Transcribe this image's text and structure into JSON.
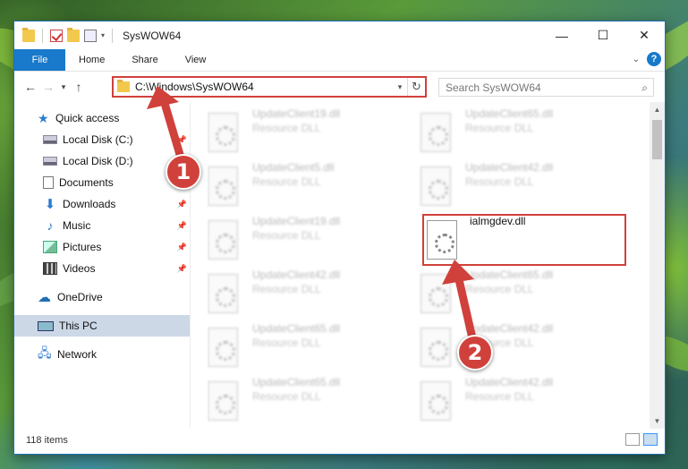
{
  "window": {
    "title": "SysWOW64",
    "minimize": "—",
    "maximize": "☐",
    "close": "✕"
  },
  "ribbon": {
    "file": "File",
    "tabs": [
      "Home",
      "Share",
      "View"
    ]
  },
  "address": {
    "path": "C:\\Windows\\SysWOW64",
    "search_placeholder": "Search SysWOW64"
  },
  "nav": {
    "quick_access": "Quick access",
    "items": [
      {
        "label": "Local Disk (C:)",
        "pinned": true
      },
      {
        "label": "Local Disk (D:)",
        "pinned": true
      },
      {
        "label": "Documents",
        "pinned": true
      },
      {
        "label": "Downloads",
        "pinned": true
      },
      {
        "label": "Music",
        "pinned": true
      },
      {
        "label": "Pictures",
        "pinned": true
      },
      {
        "label": "Videos",
        "pinned": true
      }
    ],
    "onedrive": "OneDrive",
    "this_pc": "This PC",
    "network": "Network"
  },
  "files": {
    "left": [
      {
        "name": "UpdateClient19.dll",
        "type": "Resource DLL"
      },
      {
        "name": "UpdateClient5.dll",
        "type": "Resource DLL"
      },
      {
        "name": "UpdateClient19.dll",
        "type": "Resource DLL"
      },
      {
        "name": "UpdateClient42.dll",
        "type": "Resource DLL"
      },
      {
        "name": "UpdateClient65.dll",
        "type": "Resource DLL"
      },
      {
        "name": "UpdateClient65.dll",
        "type": "Resource DLL"
      }
    ],
    "right": [
      {
        "name": "UpdateClient65.dll",
        "type": "Resource DLL"
      },
      {
        "name": "UpdateClient42.dll",
        "type": "Resource DLL"
      },
      {
        "name": "ialmgdev.dll",
        "type": ""
      },
      {
        "name": "UpdateClient65.dll",
        "type": "Resource DLL"
      },
      {
        "name": "UpdateClient42.dll",
        "type": "Resource DLL"
      },
      {
        "name": "UpdateClient42.dll",
        "type": "Resource DLL"
      }
    ]
  },
  "status": {
    "count": "118 items"
  },
  "annotations": {
    "step1": "1",
    "step2": "2",
    "color": "#d0413b"
  }
}
